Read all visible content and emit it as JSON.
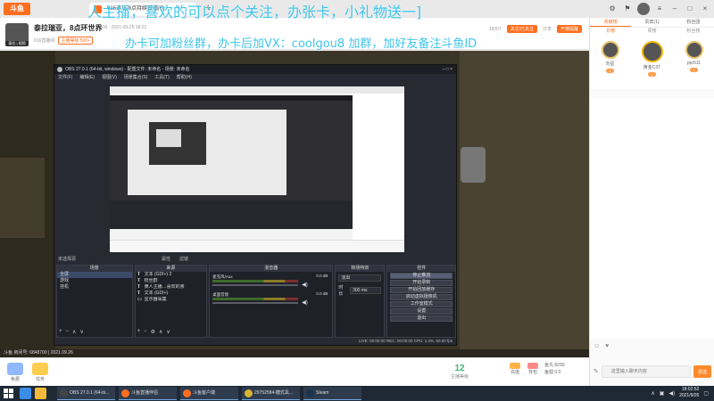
{
  "browser": {
    "logo_text": "斗鱼",
    "tab_title": "616退坑,8点持续直播间",
    "tab_close": "×",
    "tab_add": "+"
  },
  "room": {
    "avatar_caption": "泰拉 | 视频",
    "title": "泰拉瑞亚，8点环世界",
    "meta": "616  ·  2021-09-25 18:21",
    "tags": [
      "616直播间",
      "主播等级 500+"
    ],
    "report_label": "15007",
    "follow_label": "关注|已关注",
    "share_label": "分享",
    "notify_label": "开播提醒"
  },
  "overlay": {
    "line1": "人主播，喜欢的可以点个关注，办张卡，小礼物送一]",
    "line2": "办卡可加粉丝群，办卡后加VX：coolgou8 加群，加好友备注斗鱼ID"
  },
  "obs": {
    "title": "OBS 27.0.1 (64-bit, windows) - 配置文件: 未命名 - 场景: 未命名",
    "menu": [
      "文件(F)",
      "编辑(E)",
      "视图(V)",
      "场景集合(S)",
      "工具(T)",
      "帮助(H)"
    ],
    "source_status": "未选择源",
    "opt_props": "属性",
    "opt_filters": "滤镜",
    "docks": {
      "scenes": "场景",
      "sources": "来源",
      "mixer": "混音器",
      "transitions": "转场特效",
      "controls": "控件"
    },
    "scenes": [
      "全屏",
      "游戏",
      "挂机"
    ],
    "sources": [
      "文本 (GDI+) 2",
      "粉丝群",
      "黄人主播…喜欢的亲",
      "文本 (GDI+)",
      "显示器采集"
    ],
    "mixer": [
      {
        "name": "麦克风/Aux",
        "db": "0.0 dB"
      },
      {
        "name": "桌面音频",
        "db": "0.0 dB"
      }
    ],
    "transition_type": "淡出",
    "duration_label": "时长",
    "duration_value": "300 ms",
    "controls": [
      "停止推流",
      "开始录制",
      "开始回放缓存",
      "启动虚拟摄像机",
      "工作室模式",
      "设置",
      "退出"
    ],
    "footer": "LIVE: 00:00:00    REC: 00:00:00    CPU: 1.4%, 60.00 fps"
  },
  "viewer_strip": "斗鱼 房间号: 6848700 | 2021.09.26",
  "bottombar": {
    "left_items": [
      "免费",
      "任务"
    ],
    "level_num": "12",
    "level_label": "主播等级",
    "right_items": [
      "充值",
      "背包"
    ],
    "wallet_line1": "鱼丸 8290",
    "wallet_line2": "鱼翅 0.0"
  },
  "side": {
    "tabs": [
      "贡献榜",
      "贵宾(1)",
      "粉丝团"
    ],
    "sub_tabs": [
      "日榜",
      "周榜",
      "粉丝榜"
    ],
    "ranks": [
      {
        "name": "刘星",
        "badge": "1"
      },
      {
        "name": "黄金C3T",
        "badge": "1"
      },
      {
        "name": "ppr511",
        "badge": "1"
      }
    ],
    "chat_placeholder": "这里输入聊天内容",
    "send_label": "发送"
  },
  "taskbar": {
    "apps": [
      "OBS 27.0.1 (64-bi...",
      "斗鱼直播伴侣",
      "斗鱼客户端",
      "29752584-糖式具...",
      "Steam"
    ],
    "time": "18:02:52",
    "date": "2021/9/26"
  },
  "colors": {
    "accent": "#ff6e1f",
    "overlay_text": "#3fc6ec",
    "obs_bg": "#272a33"
  }
}
